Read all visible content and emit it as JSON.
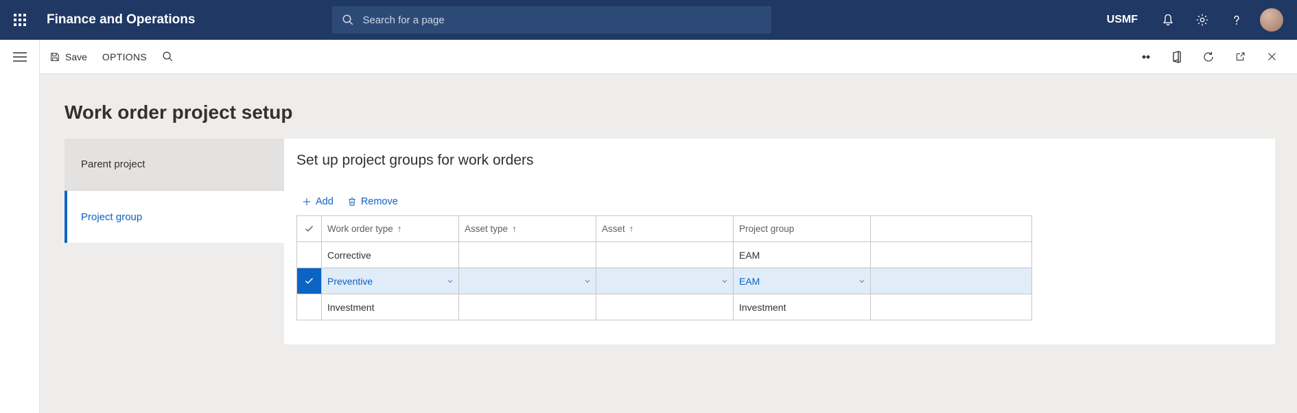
{
  "header": {
    "app_title": "Finance and Operations",
    "search_placeholder": "Search for a page",
    "company": "USMF"
  },
  "actionbar": {
    "save": "Save",
    "options": "OPTIONS"
  },
  "page": {
    "title": "Work order project setup",
    "tabs": [
      {
        "label": "Parent project",
        "active": false
      },
      {
        "label": "Project group",
        "active": true
      }
    ],
    "panel_title": "Set up project groups for work orders",
    "actions": {
      "add": "Add",
      "remove": "Remove"
    },
    "grid": {
      "columns": [
        "Work order type",
        "Asset type",
        "Asset",
        "Project group"
      ],
      "sorted_columns": [
        0,
        1,
        2
      ],
      "rows": [
        {
          "selected": false,
          "cells": [
            "Corrective",
            "",
            "",
            "EAM"
          ]
        },
        {
          "selected": true,
          "cells": [
            "Preventive",
            "",
            "",
            "EAM"
          ]
        },
        {
          "selected": false,
          "cells": [
            "Investment",
            "",
            "",
            "Investment"
          ]
        }
      ]
    }
  }
}
